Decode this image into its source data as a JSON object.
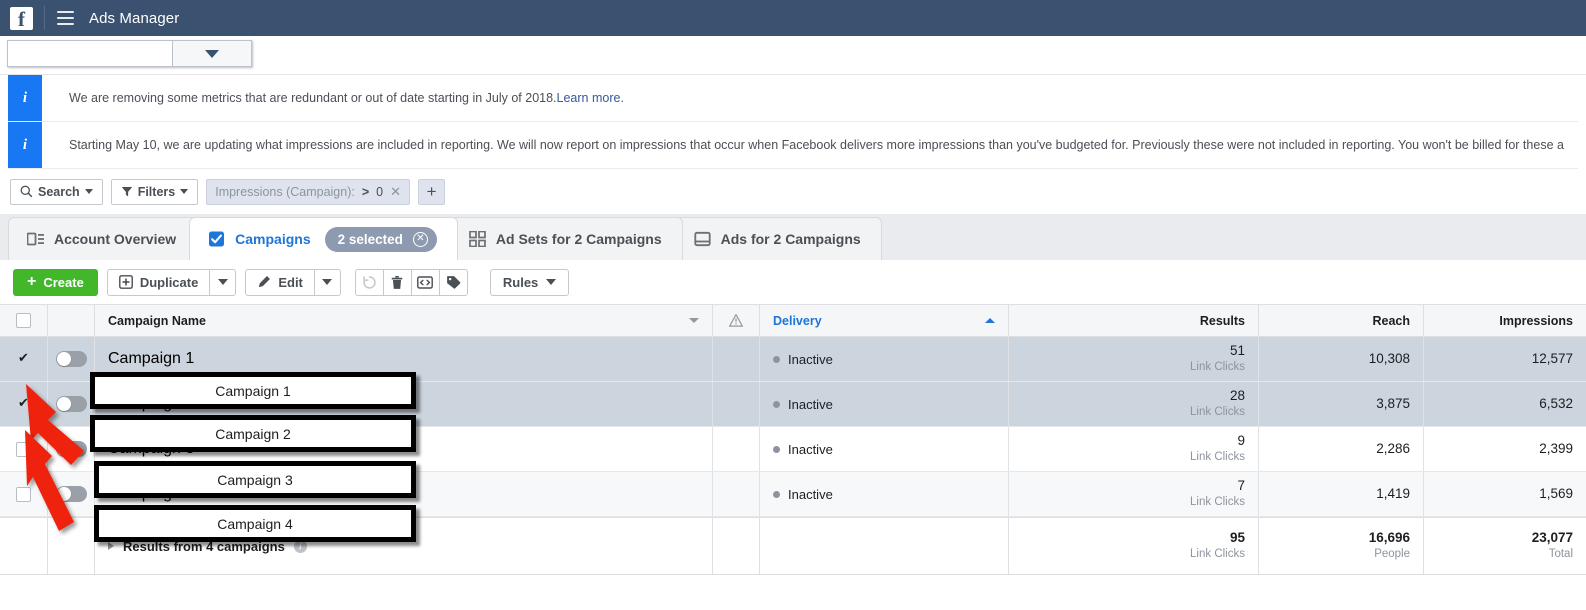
{
  "topbar": {
    "logo": "facebook-logo",
    "menu_icon": "hamburger-menu-icon",
    "title": "Ads Manager"
  },
  "account_selector": {
    "value": "",
    "placeholder": "",
    "caret_icon": "chevron-down-icon"
  },
  "banners": [
    {
      "icon": "info-icon",
      "text": "We are removing some metrics that are redundant or out of date starting in July of 2018. ",
      "link": "Learn more."
    },
    {
      "icon": "info-icon",
      "text": "Starting May 10, we are updating what impressions are included in reporting. We will now report on impressions that occur when Facebook delivers more impressions than you've budgeted for. Previously these were not included in reporting. You won't be billed for these a",
      "link": ""
    }
  ],
  "filterbar": {
    "search_label": "Search",
    "search_icon": "search-icon",
    "filters_label": "Filters",
    "filters_icon": "funnel-icon",
    "chip": {
      "label": "Impressions (Campaign):",
      "operator": ">",
      "value": "0",
      "remove_icon": "close-icon"
    },
    "add_filter_label": "+"
  },
  "tabs": [
    {
      "label": "Account Overview",
      "icon": "account-overview-icon",
      "active": false
    },
    {
      "label": "Campaigns",
      "icon": "campaigns-checkbox-icon",
      "active": true,
      "badge": "2 selected",
      "badge_close_icon": "close-circle-icon"
    },
    {
      "label": "Ad Sets for 2 Campaigns",
      "icon": "ad-sets-grid-icon",
      "active": false
    },
    {
      "label": "Ads for 2 Campaigns",
      "icon": "ads-window-icon",
      "active": false
    }
  ],
  "toolbar": {
    "create_label": "Create",
    "create_icon": "plus-icon",
    "duplicate_label": "Duplicate",
    "duplicate_icon": "duplicate-icon",
    "edit_label": "Edit",
    "edit_icon": "pencil-icon",
    "revert_icon": "revert-icon",
    "delete_icon": "trash-icon",
    "abtest_icon": "ab-test-icon",
    "tag_icon": "tag-icon",
    "rules_label": "Rules",
    "accent_green": "#42b72a"
  },
  "table": {
    "headers": {
      "select_all": "",
      "name": "Campaign Name",
      "warning_icon": "warning-icon",
      "delivery": "Delivery",
      "results": "Results",
      "reach": "Reach",
      "impressions": "Impressions",
      "sort_column": "Delivery",
      "sort_direction": "asc",
      "sort_color": "#1d76d8"
    },
    "rows": [
      {
        "name": "Campaign 1",
        "checked": true,
        "toggle_on": false,
        "delivery": "Inactive",
        "results_value": "51",
        "results_unit": "Link Clicks",
        "reach": "10,308",
        "impressions": "12,577"
      },
      {
        "name": "Campaign 2",
        "checked": true,
        "toggle_on": false,
        "delivery": "Inactive",
        "results_value": "28",
        "results_unit": "Link Clicks",
        "reach": "3,875",
        "impressions": "6,532"
      },
      {
        "name": "Campaign 3",
        "checked": false,
        "toggle_on": false,
        "delivery": "Inactive",
        "results_value": "9",
        "results_unit": "Link Clicks",
        "reach": "2,286",
        "impressions": "2,399"
      },
      {
        "name": "Campaign 4",
        "checked": false,
        "toggle_on": false,
        "delivery": "Inactive",
        "results_value": "7",
        "results_unit": "Link Clicks",
        "reach": "1,419",
        "impressions": "1,569"
      }
    ],
    "summary": {
      "label": "Results from 4 campaigns",
      "info_icon": "info-icon",
      "results_value": "95",
      "results_unit": "Link Clicks",
      "reach_value": "16,696",
      "reach_unit": "People",
      "impressions_value": "23,077",
      "impressions_unit": "Total"
    }
  },
  "annotations": {
    "arrow_color": "#ee2211",
    "boxes": [
      {
        "label": "Campaign 1"
      },
      {
        "label": "Campaign 2"
      },
      {
        "label": "Campaign 3"
      },
      {
        "label": "Campaign 4"
      }
    ]
  }
}
